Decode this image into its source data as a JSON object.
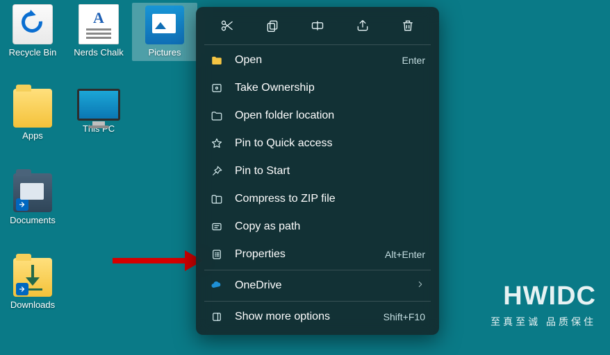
{
  "icons": {
    "recycle": "Recycle Bin",
    "nerds": "Nerds Chalk",
    "pictures": "Pictures",
    "apps": "Apps",
    "thispc": "This PC",
    "documents": "Documents",
    "downloads": "Downloads"
  },
  "menu": {
    "open": "Open",
    "open_hint": "Enter",
    "take_ownership": "Take Ownership",
    "open_location": "Open folder location",
    "pin_quick": "Pin to Quick access",
    "pin_start": "Pin to Start",
    "compress": "Compress to ZIP file",
    "copy_path": "Copy as path",
    "properties": "Properties",
    "properties_hint": "Alt+Enter",
    "onedrive": "OneDrive",
    "more": "Show more options",
    "more_hint": "Shift+F10"
  },
  "watermark": {
    "big": "HWIDC",
    "small": "至真至诚  品质保住"
  }
}
